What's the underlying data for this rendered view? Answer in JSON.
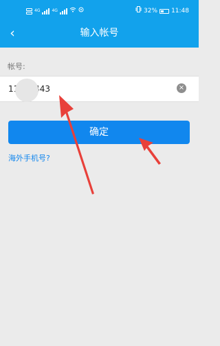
{
  "status_bar": {
    "network_labels": [
      "4G",
      "4G"
    ],
    "battery": "32%",
    "time": "11:48"
  },
  "header": {
    "back_icon": "‹",
    "title": "输入帐号"
  },
  "form": {
    "label": "帐号:",
    "account_value": "11      443",
    "clear_icon": "×"
  },
  "buttons": {
    "confirm_label": "确定"
  },
  "links": {
    "overseas_label": "海外手机号?"
  },
  "colors": {
    "header_bg": "#12a2ec",
    "button_bg": "#1187ee",
    "link": "#1287ee",
    "arrow": "#e8403a"
  }
}
